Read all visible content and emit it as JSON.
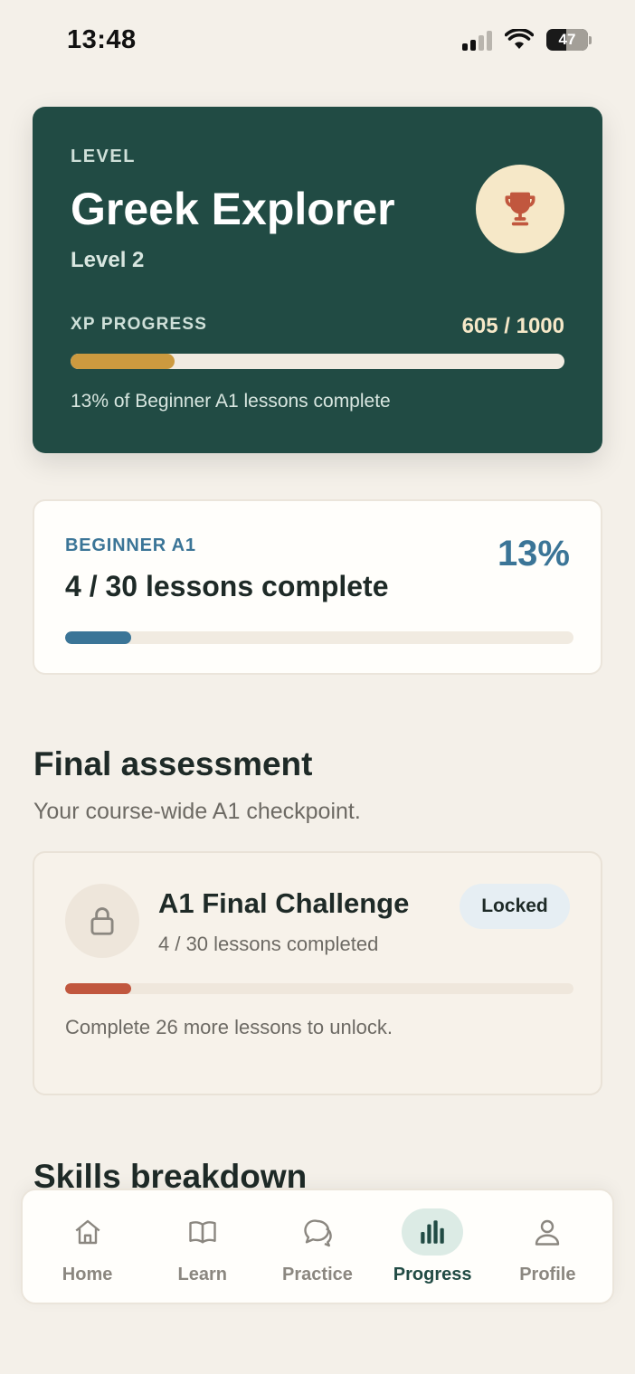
{
  "status_bar": {
    "time": "13:48",
    "battery": "47"
  },
  "level_card": {
    "eyebrow": "LEVEL",
    "title": "Greek Explorer",
    "subtitle": "Level 2",
    "xp_label": "XP PROGRESS",
    "xp_value": "605 / 1000",
    "xp_progress": 0.21,
    "note": "13% of Beginner A1 lessons complete",
    "icon": "trophy-icon"
  },
  "course_card": {
    "eyebrow": "BEGINNER A1",
    "title": "4 / 30 lessons complete",
    "percent": "13%",
    "progress": 0.13
  },
  "final_section": {
    "title": "Final assessment",
    "subtitle": "Your course-wide A1 checkpoint."
  },
  "final_card": {
    "title": "A1 Final Challenge",
    "subtitle": "4 / 30 lessons completed",
    "badge": "Locked",
    "progress": 0.13,
    "note": "Complete 26 more lessons to unlock.",
    "icon": "lock-icon"
  },
  "next_section": {
    "title": "Skills breakdown"
  },
  "tab_bar": {
    "items": [
      {
        "label": "Home",
        "icon": "home-icon",
        "active": false
      },
      {
        "label": "Learn",
        "icon": "book-icon",
        "active": false
      },
      {
        "label": "Practice",
        "icon": "chat-icon",
        "active": false
      },
      {
        "label": "Progress",
        "icon": "bar-chart-icon",
        "active": true
      },
      {
        "label": "Profile",
        "icon": "user-icon",
        "active": false
      }
    ]
  },
  "colors": {
    "background": "#f4f0e9",
    "primary": "#214b44",
    "accent_gold": "#cc9a3f",
    "accent_blue": "#3b7597",
    "accent_red": "#c1573e"
  }
}
